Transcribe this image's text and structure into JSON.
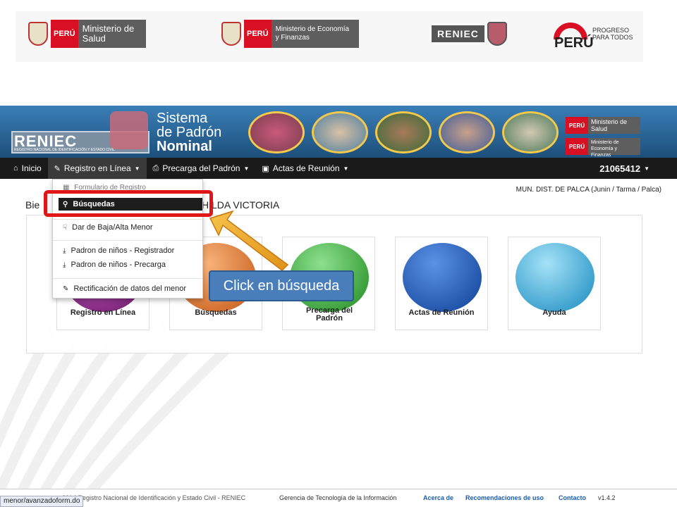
{
  "top_logos": {
    "peru": "PERÚ",
    "salud": "Ministerio de Salud",
    "economia": "Ministerio de Economía y Finanzas",
    "reniec": "RENIEC",
    "peru_progreso_word": "PERÚ",
    "peru_progreso_tag": "PROGRESO PARA TODOS"
  },
  "banner": {
    "reniec": "RENIEC",
    "reniec_sub": "REGISTRO NACIONAL DE IDENTIFICACIÓN Y ESTADO CIVIL",
    "title_l1": "Sistema",
    "title_l2": "de Padrón",
    "title_l3": "Nominal",
    "peru_tag": "PERÚ",
    "salud": "Ministerio de Salud",
    "economia": "Ministerio de Economía y Finanzas"
  },
  "navbar": {
    "inicio": "Inicio",
    "registro": "Registro en Línea",
    "precarga": "Precarga del Padrón",
    "actas": "Actas de Reunión",
    "user": "21065412"
  },
  "location": "MUN. DIST. DE PALCA (Junin / Tarma / Palca)",
  "welcome_left": "Bie",
  "welcome_right": "HILDA VICTORIA",
  "dropdown": {
    "top_faded": "Formulario de Registro",
    "busquedas": "Búsquedas",
    "baja_alta": "Dar de Baja/Alta Menor",
    "padron_registrador": "Padron de niños - Registrador",
    "padron_precarga": "Padron de niños - Precarga",
    "rectificacion": "Rectificación de datos del menor"
  },
  "tiles": [
    {
      "label": "Registro en Línea",
      "color": "#8e2a8c"
    },
    {
      "label": "Búsquedas",
      "color": "#e07a2b"
    },
    {
      "label": "Precarga del Padrón",
      "color": "#3fb43f"
    },
    {
      "label": "Actas de Reunión",
      "color": "#1e5fc4"
    },
    {
      "label": "Ayuda",
      "color": "#3bb0e0"
    }
  ],
  "callout": "Click en búsqueda",
  "footer": {
    "copyright": "2014 Registro Nacional de Identificación y Estado Civil - RENIEC",
    "gerencia": "Gerencia de Tecnología de la Información",
    "acerca": "Acerca de",
    "recomendaciones": "Recomendaciones de uso",
    "contacto": "Contacto",
    "version": "v1.4.2"
  },
  "status_url": "menor/avanzadoform.do",
  "colors": {
    "highlight": "#e01616",
    "callout_bg": "#4a7ebb",
    "navbar": "#1a1a1a"
  }
}
